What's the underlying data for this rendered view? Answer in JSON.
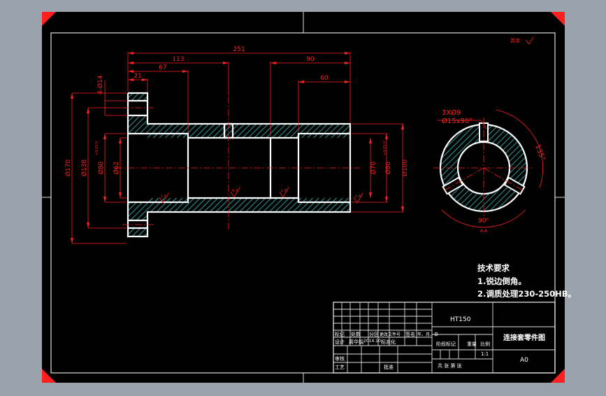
{
  "colors": {
    "background": "#9aa2ac",
    "sheet": "#000000",
    "frame": "#e0e0e0",
    "corner": "#ff1f1f",
    "part_outline": "#ffffff",
    "hatch": "#2e8f8f",
    "dimension": "#ff2020",
    "centerline": "#ff2020"
  },
  "dimensions": {
    "overall_length": "251",
    "length_113": "113",
    "length_67": "67",
    "length_21": "21",
    "length_90": "90",
    "length_60": "60",
    "holes": "4-Ø14",
    "dia_170": "Ø170",
    "dia_138": "Ø138",
    "dia_80_tol_left": "Ø80",
    "dia_62": "Ø62",
    "dia_70": "Ø70",
    "dia_80_tol_right": "Ø80",
    "dia_100": "Ø100",
    "tolerance": "+0.03\n0",
    "roughness_1": "1.6",
    "roughness_2": "6.3",
    "roughness_3": "1.6",
    "roughness_4": "1.6"
  },
  "end_view": {
    "holes_label": "3XØ9",
    "chamfer_label": "Ø15x90°",
    "angle_135": "135°",
    "angle_90": "90°",
    "section_label": "A-A"
  },
  "corner_mark": "其余",
  "technical_requirements": {
    "heading": "技术要求",
    "item1": "1.锐边倒角。",
    "item2": "2.调质处理230-250HB。"
  },
  "title_block": {
    "material": "HT150",
    "drawing_name": "连接套零件图",
    "drawing_code": "A0",
    "header_row": [
      "标记",
      "处数",
      "分区",
      "更改文件号",
      "签名",
      "年、月、日"
    ],
    "design_label": "设计",
    "designer": "周华娟",
    "date": "2014.10",
    "standardization": "标准化",
    "stage_label": "阶段标记",
    "weight_label": "重量",
    "scale_label": "比例",
    "scale_value": "1:1",
    "review_label": "审核",
    "process_label": "工艺",
    "approve_label": "批准",
    "sheets_label": "共  张  第  张"
  }
}
